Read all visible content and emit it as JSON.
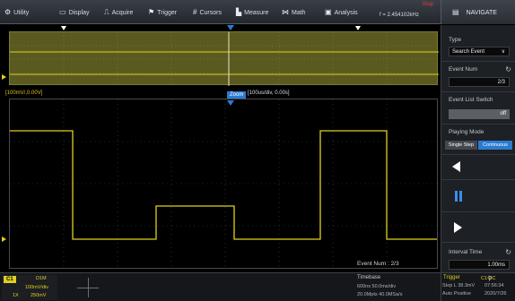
{
  "menu": {
    "items": [
      {
        "label": "Utility",
        "icon": "gear-icon",
        "glyph": "⚙"
      },
      {
        "label": "Display",
        "icon": "display-icon",
        "glyph": "▭"
      },
      {
        "label": "Acquire",
        "icon": "acquire-icon",
        "glyph": "⎍"
      },
      {
        "label": "Trigger",
        "icon": "trigger-icon",
        "glyph": "⚑"
      },
      {
        "label": "Cursors",
        "icon": "cursors-icon",
        "glyph": "#"
      },
      {
        "label": "Measure",
        "icon": "measure-icon",
        "glyph": "▙"
      },
      {
        "label": "Math",
        "icon": "math-icon",
        "glyph": "⋈"
      },
      {
        "label": "Analysis",
        "icon": "analysis-icon",
        "glyph": "▣"
      }
    ],
    "run_state": "Stop",
    "frequency": "f = 2.454102kHz",
    "navigate_label": "NAVIGATE"
  },
  "screen": {
    "zoom_label": "[100mV/,0.00V]",
    "zoom_tag": "Zoom",
    "zoom_info": "[100us/div, 0.00s]",
    "event_num": "Event Num : 2/3"
  },
  "panel": {
    "type_label": "Type",
    "type_value": "Search Event",
    "event_num_label": "Event Num",
    "event_num_value": "2/3",
    "event_list_label": "Event List Switch",
    "event_list_value": "off",
    "playing_mode_label": "Playing Mode",
    "mode_single": "Single Step",
    "mode_continuous": "Continuous",
    "interval_label": "Interval Time",
    "interval_value": "1.00ms"
  },
  "status": {
    "ch1": {
      "tag": "C1",
      "coupling": "D1M",
      "scale": "100mV/div",
      "offset": "250mV",
      "probe": "1X"
    },
    "timebase": {
      "label": "Timebase",
      "line1": "600ns  50.0ms/div",
      "line2": "20.0Mpts  40.0MSa/s"
    },
    "trigger": {
      "label": "Trigger",
      "source": "C1 DC",
      "line1": "Stop   L 38.3mV",
      "line2": "Auto    Positive"
    },
    "clock": {
      "time": "07:56:34",
      "date": "2020/7/26"
    }
  },
  "colors": {
    "ch1": "#e0d020",
    "accent": "#2a7bd0",
    "stop": "#e23a3a"
  }
}
